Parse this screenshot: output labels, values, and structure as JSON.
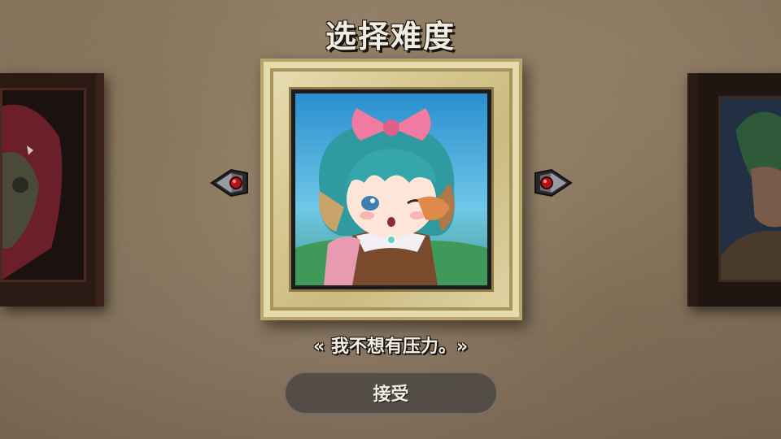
{
  "header": {
    "title": "选择难度"
  },
  "difficulty": {
    "quote": "« 我不想有压力。»",
    "accept_label": "接受"
  },
  "icons": {
    "prev": "left-arrow-red-gem-icon",
    "next": "right-arrow-red-gem-icon"
  },
  "colors": {
    "gold_frame": "#d7c891",
    "dark_frame": "#2b1a14",
    "button": "#46443f",
    "text": "#f2ede2"
  }
}
